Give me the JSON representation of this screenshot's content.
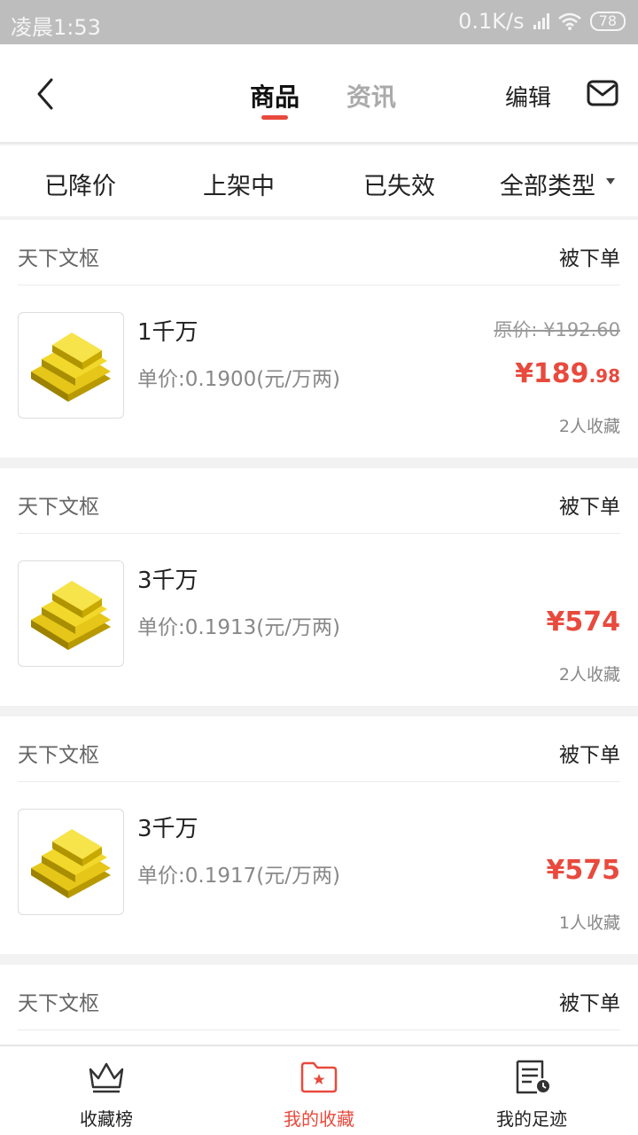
{
  "status_bar": {
    "time": "凌晨1:53",
    "speed": "0.1K/s",
    "battery": "78"
  },
  "header": {
    "tabs": [
      "商品",
      "资讯"
    ],
    "edit_label": "编辑"
  },
  "filters": [
    "已降价",
    "上架中",
    "已失效",
    "全部类型"
  ],
  "items": [
    {
      "shop": "天下文枢",
      "status": "被下单",
      "title": "1千万",
      "unit_price": "单价:0.1900(元/万两)",
      "original_price": "原价: ¥192.60",
      "price_int": "¥189",
      "price_dec": ".98",
      "favorites": "2人收藏"
    },
    {
      "shop": "天下文枢",
      "status": "被下单",
      "title": "3千万",
      "unit_price": "单价:0.1913(元/万两)",
      "original_price": "",
      "price_int": "¥574",
      "price_dec": "",
      "favorites": "2人收藏"
    },
    {
      "shop": "天下文枢",
      "status": "被下单",
      "title": "3千万",
      "unit_price": "单价:0.1917(元/万两)",
      "original_price": "",
      "price_int": "¥575",
      "price_dec": "",
      "favorites": "1人收藏"
    },
    {
      "shop": "天下文枢",
      "status": "被下单"
    }
  ],
  "bottom_nav": [
    {
      "label": "收藏榜",
      "icon": "crown-icon"
    },
    {
      "label": "我的收藏",
      "icon": "star-folder-icon"
    },
    {
      "label": "我的足迹",
      "icon": "history-icon"
    }
  ],
  "colors": {
    "accent": "#e84a3d",
    "gold": "#e6c619"
  }
}
